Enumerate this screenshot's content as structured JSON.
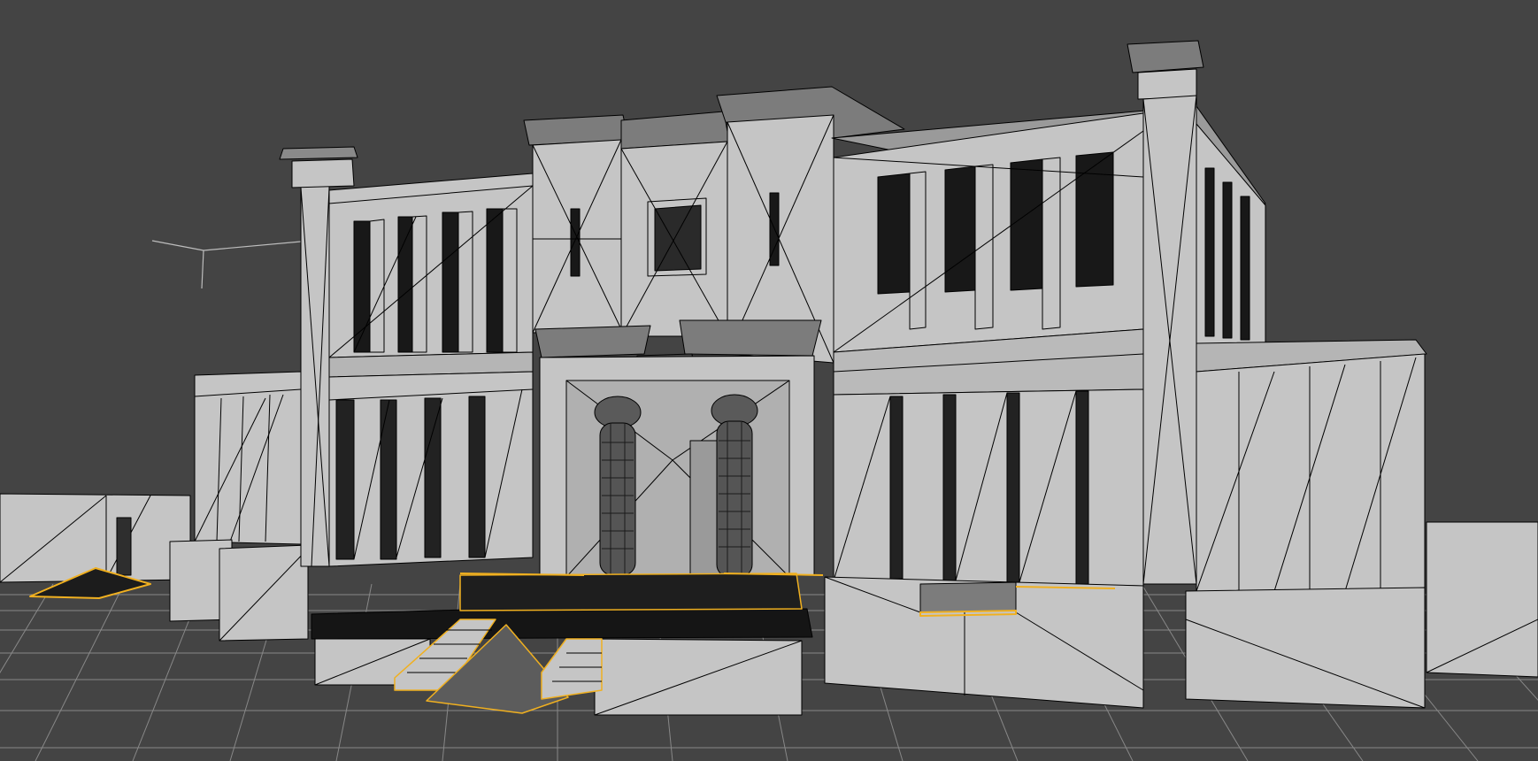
{
  "viewport": {
    "kind": "3d-perspective-viewport",
    "shading": "wireframe-over-shaded",
    "background_color": "#444444",
    "grid_color": "#888888",
    "mesh_face_color": "#c5c5c5",
    "mesh_edge_color": "#000000",
    "selection_color": "#f0b020",
    "dark_recess_color": "#121212",
    "grid_visible": true,
    "scene_object": "temple-facade-model"
  }
}
